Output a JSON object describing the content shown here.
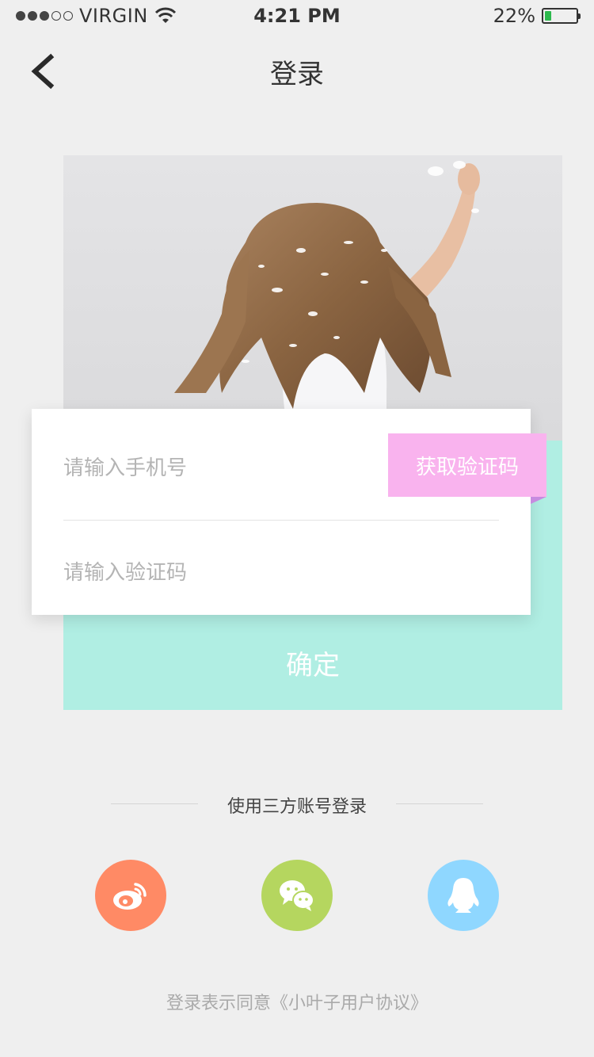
{
  "status_bar": {
    "carrier": "VIRGIN",
    "time": "4:21 PM",
    "battery": "22%",
    "battery_level": 0.22,
    "signal_filled": 3,
    "signal_total": 5
  },
  "nav": {
    "title": "登录",
    "back_icon": "chevron-left-icon"
  },
  "hero": {
    "image": "girl-with-feathers-photo"
  },
  "form": {
    "phone_placeholder": "请输入手机号",
    "code_placeholder": "请输入验证码",
    "get_code_label": "获取验证码",
    "confirm_label": "确定"
  },
  "third_party": {
    "title": "使用三方账号登录",
    "providers": [
      {
        "name": "weibo",
        "icon": "weibo-icon",
        "color": "#ff8a65"
      },
      {
        "name": "wechat",
        "icon": "wechat-icon",
        "color": "#b5d65f"
      },
      {
        "name": "qq",
        "icon": "qq-icon",
        "color": "#8fd7ff"
      }
    ]
  },
  "agreement": "登录表示同意《小叶子用户协议》",
  "colors": {
    "mint": "#b0eee3",
    "pink": "#f9b3ee",
    "background": "#efefef",
    "battery_green": "#2db94d"
  }
}
